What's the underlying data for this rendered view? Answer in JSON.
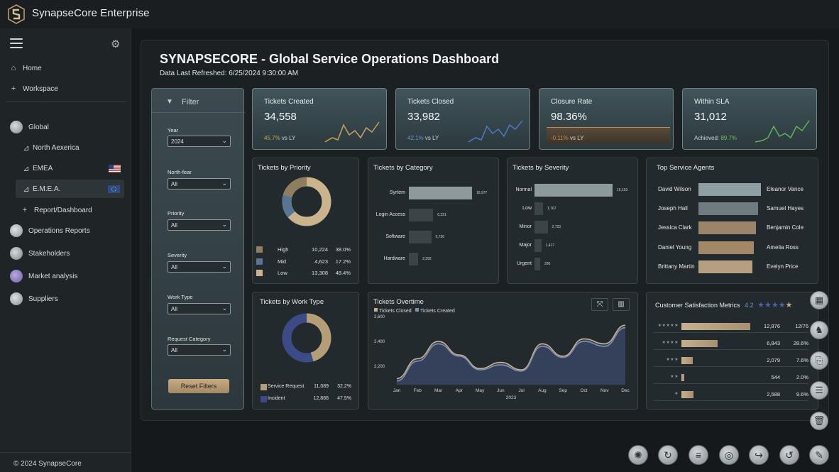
{
  "app": {
    "title": "SynapseCore Enterprise",
    "copyright": "© 2024 SynapseCore"
  },
  "sidebar": {
    "items": [
      {
        "label": "Home",
        "icon": "home-icon"
      },
      {
        "label": "Workspace",
        "icon": "plus-icon"
      },
      {
        "label": "Global",
        "icon": "globe-icon"
      },
      {
        "label": "North Aexerica",
        "icon": "chart-icon"
      },
      {
        "label": "EMEA",
        "icon": "chart-icon",
        "flag": "us-flag"
      },
      {
        "label": "E.M.E.A.",
        "icon": "chart-icon",
        "flag": "eu-flag"
      },
      {
        "label": "Report/Dashboard",
        "icon": "plus-icon"
      },
      {
        "label": "Operations Reports",
        "icon": "person-icon"
      },
      {
        "label": "Stakeholders",
        "icon": "people-icon"
      },
      {
        "label": "Market analysis",
        "icon": "analysis-icon"
      },
      {
        "label": "Suppliers",
        "icon": "suppliers-icon"
      }
    ]
  },
  "header": {
    "title": "SYNAPSECORE - Global Service Operations Dashboard",
    "refreshed": "Data Last Refreshed: 6/25/2024 9:30:00 AM"
  },
  "filter": {
    "title": "Filter",
    "fields": [
      {
        "label": "Year",
        "value": "2024"
      },
      {
        "label": "North-fear",
        "value": "All"
      },
      {
        "label": "Priority",
        "value": "All"
      },
      {
        "label": "Severity",
        "value": "All"
      },
      {
        "label": "Work Type",
        "value": "All"
      },
      {
        "label": "Request Category",
        "value": "All"
      }
    ],
    "reset_label": "Reset Filters"
  },
  "kpis": [
    {
      "title": "Tickets Created",
      "value": "34,558",
      "delta": "45.7%",
      "delta_suffix": " vs LY",
      "color": "#c9a15f"
    },
    {
      "title": "Tickets Closed",
      "value": "33,982",
      "delta": "42.1%",
      "delta_suffix": " vs LY",
      "color": "#4f78c8"
    },
    {
      "title": "Closure Rate",
      "value": "98.36%",
      "delta": "-0.11%",
      "delta_suffix": " vs LY",
      "color": "#c98a4a"
    },
    {
      "title": "Within SLA",
      "value": "31,012",
      "delta_prefix": "Achieved: ",
      "delta": "89.7%",
      "color": "#5fb35a"
    }
  ],
  "priority": {
    "title": "Tickets by Priority",
    "rows": [
      {
        "label": "High",
        "count": "10,224",
        "pct": "38.0%",
        "color": "#8f7d5f"
      },
      {
        "label": "Mid",
        "count": "4,623",
        "pct": "17.2%",
        "color": "#5a7592"
      },
      {
        "label": "Low",
        "count": "13,308",
        "pct": "48.4%",
        "color": "#c9b48d"
      }
    ]
  },
  "category": {
    "title": "Tickets by Category",
    "rows": [
      {
        "label": "Syrtem",
        "value": 16197,
        "value_label": "16,977"
      },
      {
        "label": "Login Access",
        "value": 6231,
        "value_label": "6,231"
      },
      {
        "label": "Software",
        "value": 5736,
        "value_label": "5,736"
      },
      {
        "label": "Hardware",
        "value": 2392,
        "value_label": "2,392"
      }
    ]
  },
  "severity": {
    "title": "Tickets by Severity",
    "rows": [
      {
        "label": "Normal",
        "value": 16153,
        "value_label": "16,153"
      },
      {
        "label": "Low",
        "value": 1767,
        "value_label": "1,767"
      },
      {
        "label": "Minor",
        "value": 2723,
        "value_label": "2,723"
      },
      {
        "label": "Major",
        "value": 1417,
        "value_label": "1,417"
      },
      {
        "label": "Urgent",
        "value": 290,
        "value_label": "290"
      }
    ]
  },
  "agents": {
    "title": "Top Service Agents",
    "rows": [
      {
        "left": "David Wilson",
        "right": "Eleanor Vance",
        "color": "#8e9ea3"
      },
      {
        "left": "Joseph Hall",
        "right": "Samuel Hayes",
        "color": "#6f7b80"
      },
      {
        "left": "Jessica Clark",
        "right": "Benjamin Cole",
        "color": "#9b836c"
      },
      {
        "left": "Daniel Young",
        "right": "Amelia Ross",
        "color": "#a48668"
      },
      {
        "left": "Brittany Martin",
        "right": "Evelyn Price",
        "color": "#b69e80"
      }
    ]
  },
  "worktype": {
    "title": "Tickets by Work Type",
    "rows": [
      {
        "label": "Service Request",
        "count": "11,089",
        "pct": "32.2%",
        "color": "#b59d78"
      },
      {
        "label": "Incident",
        "count": "12,866",
        "pct": "47.5%",
        "color": "#3c4a86"
      }
    ]
  },
  "satisfaction": {
    "title": "Customer Satisfaction Metrics",
    "score": "4.2",
    "rows": [
      {
        "stars": "★★★★★",
        "fill": 1.0,
        "count": "12,876",
        "pct": "12/76"
      },
      {
        "stars": "★★★★",
        "fill": 0.53,
        "count": "6,843",
        "pct": "28.6%"
      },
      {
        "stars": "★★★",
        "fill": 0.16,
        "count": "2,079",
        "pct": "7.6%"
      },
      {
        "stars": "★★",
        "fill": 0.04,
        "count": "544",
        "pct": "2.0%"
      },
      {
        "stars": "★",
        "fill": 0.18,
        "count": "2,588",
        "pct": "9.6%"
      }
    ]
  },
  "chart_data": {
    "type": "line",
    "title": "Tickets Overtime",
    "categories": [
      "Jan",
      "Feb",
      "Mar",
      "Apr",
      "May",
      "Jun",
      "Jul",
      "Aug",
      "Sep",
      "Oct",
      "Nov",
      "Dec"
    ],
    "xlabel": "2023",
    "ylim": [
      2050,
      2600
    ],
    "y_ticks": [
      "2,600",
      "2,400",
      "2,200"
    ],
    "y_tick_values": [
      2600,
      2400,
      2200
    ],
    "grid": false,
    "legend": "top-left",
    "series": [
      {
        "name": "Tickets Closed",
        "color": "#c9b08c",
        "values": [
          2100,
          2260,
          2400,
          2290,
          2180,
          2230,
          2170,
          2380,
          2280,
          2420,
          2380,
          2530
        ]
      },
      {
        "name": "Tickets Created",
        "color": "#7f8fb0",
        "values": [
          2080,
          2240,
          2380,
          2280,
          2170,
          2210,
          2160,
          2360,
          2270,
          2400,
          2360,
          2510
        ]
      }
    ]
  }
}
